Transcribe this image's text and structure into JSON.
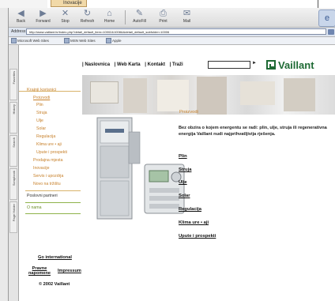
{
  "background_doc": {
    "tab_label": "Inovacije"
  },
  "toolbar": {
    "buttons": [
      {
        "label": "Back",
        "icon": "◀"
      },
      {
        "label": "Forward",
        "icon": "▶"
      },
      {
        "label": "Stop",
        "icon": "✕"
      },
      {
        "label": "Refresh",
        "icon": "↻"
      },
      {
        "label": "Home",
        "icon": "⌂"
      },
      {
        "label": "AutoFill",
        "icon": "✎"
      },
      {
        "label": "Print",
        "icon": "⎙"
      },
      {
        "label": "Mail",
        "icon": "✉"
      }
    ]
  },
  "address": {
    "label": "Address:",
    "url": "http://www.vaillant.hr/index.php?detail_default_item=10002&1008&&detail_default_subfolder=10006"
  },
  "favorites": [
    "Microsoft Web Sites",
    "MSN Web Sites",
    "Apple"
  ],
  "sidetabs": [
    "Favorites",
    "History",
    "Search",
    "Scrapbook",
    "Page Holder"
  ],
  "site": {
    "nav": [
      "| Naslovnica",
      "| Web Karta",
      "| Kontakt",
      "| Traži"
    ],
    "search_go": "►",
    "logo": "Vaillant",
    "left_nav": {
      "section_title": "Krajnji korisnici",
      "items": [
        "Proizvodi",
        "Plin",
        "Struja",
        "Ulje",
        "Solar",
        "Regulacija",
        "Klima ure • aji",
        "Upute i prospekti",
        "Prodajna mjesta",
        "Inovacije",
        "Servis i upozdrja",
        "Novo na tržištu"
      ],
      "partners_title": "Poslovni partneri",
      "about": "O nama"
    },
    "main": {
      "heading": "Proizvodi",
      "intro": "Bez obzira o kojem energentu se radi: plin, ulje, struja ili regenerativna energija Vaillant nudi najprihvatljivija rješenja.",
      "links": [
        "Plin",
        "Struja",
        "Ulje",
        "Solar",
        "Regulacija",
        "Klima ure • aji",
        "Upute i prospekti"
      ]
    },
    "footer": {
      "go_international": "Go international",
      "pravne": "Pravne napomene",
      "impressum": "Impressum",
      "copyright": "© 2002 Vaillant"
    }
  },
  "colors": {
    "accent_orange": "#c7802a",
    "logo_green": "#1e6a34",
    "partner_green": "#6c8f2a"
  }
}
